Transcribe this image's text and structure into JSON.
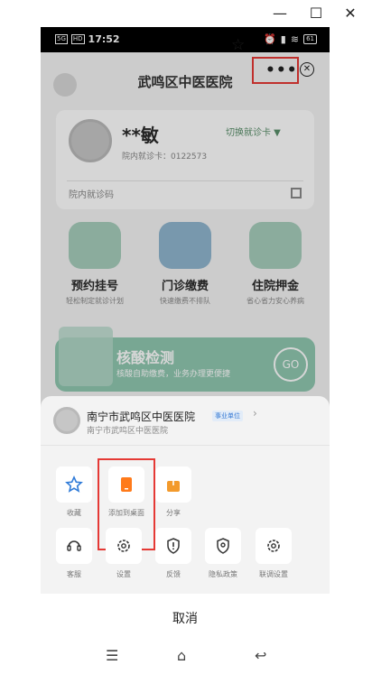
{
  "window": {
    "minimize": "—",
    "maximize": "☐",
    "close": "✕"
  },
  "status_bar": {
    "signal": "5G",
    "hd": "HD",
    "time": "17:52",
    "battery": "61"
  },
  "header": {
    "title": "武鸣区中医医院"
  },
  "patient_card": {
    "name": "**敏",
    "switch_label": "切换就诊卡 ▼",
    "card_number": "院内就诊卡：0122573",
    "code_label": "院内就诊码"
  },
  "services": [
    {
      "title": "预约挂号",
      "subtitle": "轻松制定就诊计划"
    },
    {
      "title": "门诊缴费",
      "subtitle": "快速缴费不排队"
    },
    {
      "title": "住院押金",
      "subtitle": "省心省力安心养病"
    }
  ],
  "banner": {
    "title": "核酸检测",
    "subtitle": "核酸自助缴费，业务办理更便捷",
    "go_label": "GO"
  },
  "sheet": {
    "mini_program": {
      "name": "南宁市武鸣区中医医院",
      "badge": "事业单位",
      "subtitle": "南宁市武鸣区中医医院"
    },
    "row1": [
      {
        "label": "收藏"
      },
      {
        "label": "添加到桌面"
      },
      {
        "label": "分享"
      }
    ],
    "row2": [
      {
        "label": "客服"
      },
      {
        "label": "设置"
      },
      {
        "label": "反馈"
      },
      {
        "label": "隐私政策"
      },
      {
        "label": "联调设置"
      }
    ],
    "cancel": "取消"
  },
  "colors": {
    "highlight": "#e53935",
    "add_to_desktop": "#ff7a1a",
    "favorite_star": "#2f7bd8",
    "share": "#f39a2c"
  }
}
